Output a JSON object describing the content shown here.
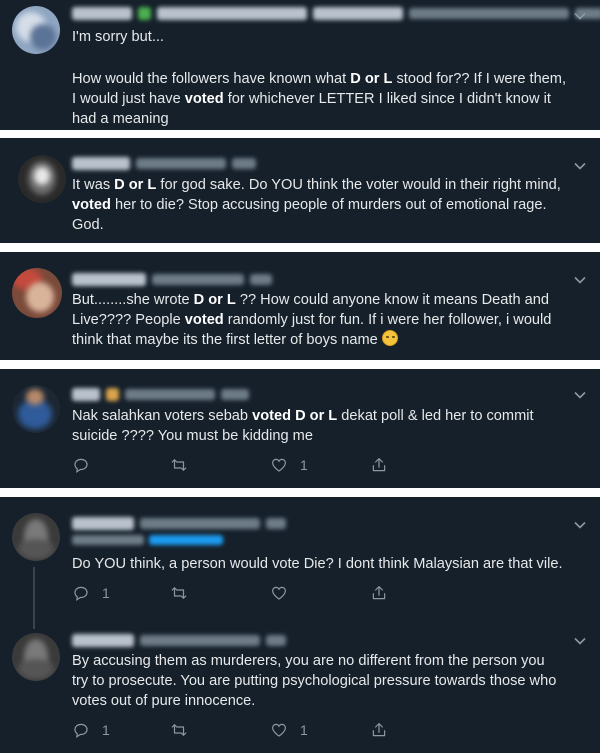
{
  "icons": {
    "chevron": "chevron-down-icon",
    "reply": "reply-icon",
    "retweet": "retweet-icon",
    "like": "heart-icon",
    "share": "share-icon"
  },
  "colors": {
    "background": "#15202b",
    "divider": "#ffffff",
    "text": "#e7e9ea",
    "muted": "#8b98a5"
  },
  "tweets": [
    {
      "lines": [
        "I'm sorry but...",
        "",
        "How would the followers have known what <b>D or L</b> stood for?? If I were them,",
        "I would just have <b>voted</b> for whichever LETTER I liked since I didn't know it",
        "had a meaning"
      ]
    },
    {
      "lines": [
        "It was <b>D or L</b> for god sake. Do YOU think the voter would in their right mind,",
        "<b>voted</b> her to die? Stop accusing people of murders out of emotional rage.",
        "God."
      ]
    },
    {
      "lines": [
        "But........she wrote <b>D or L</b> ?? How could anyone know it means Death and",
        "Live???? People <b>voted</b> randomly just for fun. If i were her follower, i would",
        "think that maybe its the first letter of boys name"
      ]
    },
    {
      "lines": [
        "Nak salahkan voters sebab <b>voted D or L</b> dekat poll & led her to commit",
        "suicide ???? You must be kidding me"
      ],
      "like_count": "1"
    },
    {
      "lines": [
        "Do YOU think, a person would vote Die? I dont think Malaysian are that vile."
      ],
      "reply_count": "1"
    },
    {
      "lines": [
        "By accusing them as murderers, you are no different from the person you",
        "try to prosecute. You are putting psychological pressure towards those who",
        "votes out of pure innocence."
      ],
      "reply_count": "1",
      "like_count": "1"
    }
  ]
}
